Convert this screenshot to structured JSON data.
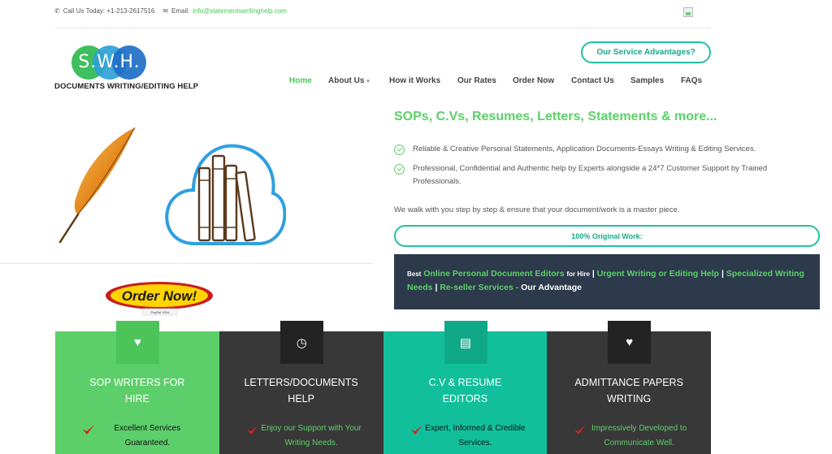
{
  "topbar": {
    "phone": "Call Us Today: +1-213-2617516",
    "email_label": "Email:",
    "email": "info@statementswritinghelp.com"
  },
  "logo": {
    "text": "S.W.H.",
    "tagline": "DOCUMENTS WRITING/EDITING HELP"
  },
  "header": {
    "advantages_button": "Our Service Advantages?"
  },
  "nav": {
    "items": [
      {
        "label": "Home",
        "active": true
      },
      {
        "label": "About Us",
        "has_dropdown": true
      },
      {
        "label": "How it Works"
      },
      {
        "label": "Our Rates"
      },
      {
        "label": "Order Now"
      },
      {
        "label": "Contact Us"
      },
      {
        "label": "Samples"
      },
      {
        "label": "FAQs"
      }
    ]
  },
  "hero": {
    "headline": "SOPs, C.Vs, Resumes, Letters, Statements & more...",
    "bullets": [
      "Reliable & Creative Personal Statements, Application Documents-Essays Writing & Editing Services.",
      "Professional, Confidential and Authentic help by Experts alongside a 24*7 Customer Support by Trained Professionals."
    ],
    "walk_text": "We walk with you step by step & ensure that your document/work is a master piece.",
    "original_button": "100% Original Work:"
  },
  "order_now": {
    "label": "Order Now!",
    "cards": "PayPal VISA"
  },
  "dark_box": {
    "best": "Best",
    "link1": "Online Personal Document Editors",
    "for_hire": "for Hire",
    "sep": "|",
    "link2": "Urgent Writing or Editing Help",
    "link3": "Specialized Writing Needs",
    "link4": "Re-seller Services",
    "dash": "-",
    "tail": "Our Advantage"
  },
  "cards": [
    {
      "title": "SOP WRITERS FOR HIRE",
      "feature": "Excellent Services Guaranteed.",
      "icon": "heart-icon",
      "bg": "#5dcf6a",
      "icon_bg": "#4cc45a",
      "feature_color": "#111111"
    },
    {
      "title": "LETTERS/DOCUMENTS HELP",
      "feature": "Enjoy our Support with Your Writing Needs.",
      "icon": "clock-icon",
      "bg": "#383838",
      "icon_bg": "#232323",
      "feature_color": "#5dcf6a"
    },
    {
      "title": "C.V & RESUME EDITORS",
      "feature": "Expert, Informed & Credible Services.",
      "icon": "clipboard-icon",
      "bg": "#12bf9c",
      "icon_bg": "#0fa98a",
      "feature_color": "#111111"
    },
    {
      "title": "ADMITTANCE PAPERS WRITING",
      "feature": "Impressively Developed to Communicate Well.",
      "icon": "heart-icon",
      "bg": "#383838",
      "icon_bg": "#232323",
      "feature_color": "#5dcf6a"
    }
  ],
  "colors": {
    "accent_green": "#5dcf6a",
    "teal": "#23c0a1",
    "dark_navy": "#2c3a4b"
  }
}
